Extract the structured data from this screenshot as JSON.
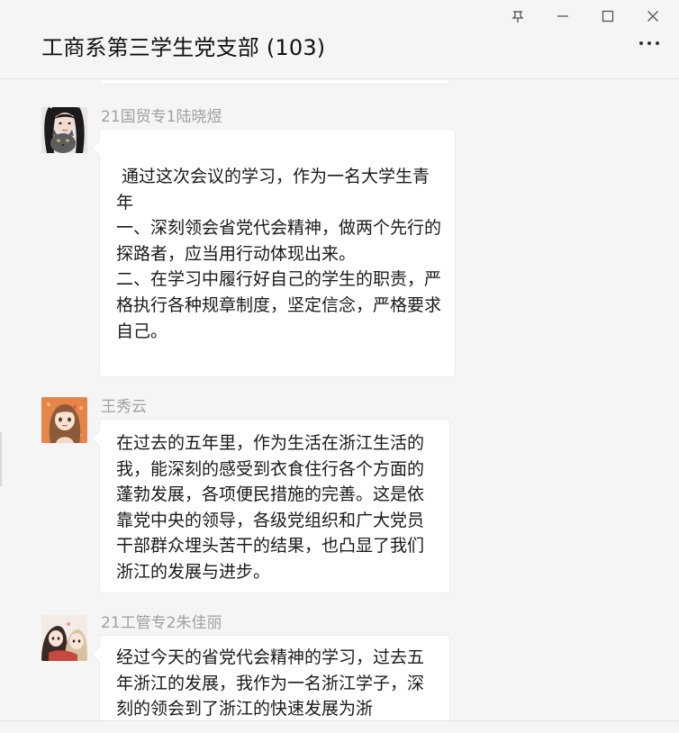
{
  "window": {
    "controls": {
      "pin_label": "pin",
      "minimize_label": "minimize",
      "maximize_label": "maximize",
      "close_label": "close"
    }
  },
  "header": {
    "title": "工商系第三学生党支部 (103)"
  },
  "messages": [
    {
      "sender": "21国贸专1陆晓煜",
      "avatar": "avatar-girl-with-cat",
      "text": " 通过这次会议的学习，作为一名大学生青年\n一、深刻领会省党代会精神，做两个先行的探路者，应当用行动体现出来。\n二、在学习中履行好自己的学生的职责，严格执行各种规章制度，坚定信念，严格要求自己。"
    },
    {
      "sender": "王秀云",
      "avatar": "avatar-anime-girl-orange",
      "text": "在过去的五年里，作为生活在浙江生活的我，能深刻的感受到衣食住行各个方面的蓬勃发展，各项便民措施的完善。这是依靠党中央的领导，各级党组织和广大党员干部群众埋头苦干的结果，也凸显了我们浙江的发展与进步。"
    },
    {
      "sender": "21工管专2朱佳丽",
      "avatar": "avatar-anime-couple",
      "text": "经过今天的省党代会精神的学习，过去五年浙江的发展，我作为一名浙江学子，深刻的领会到了浙江的快速发展为浙"
    }
  ],
  "colors": {
    "background": "#f5f5f5",
    "bubble": "#ffffff",
    "sender_name": "#a0a0a0",
    "text": "#1a1a1a"
  }
}
